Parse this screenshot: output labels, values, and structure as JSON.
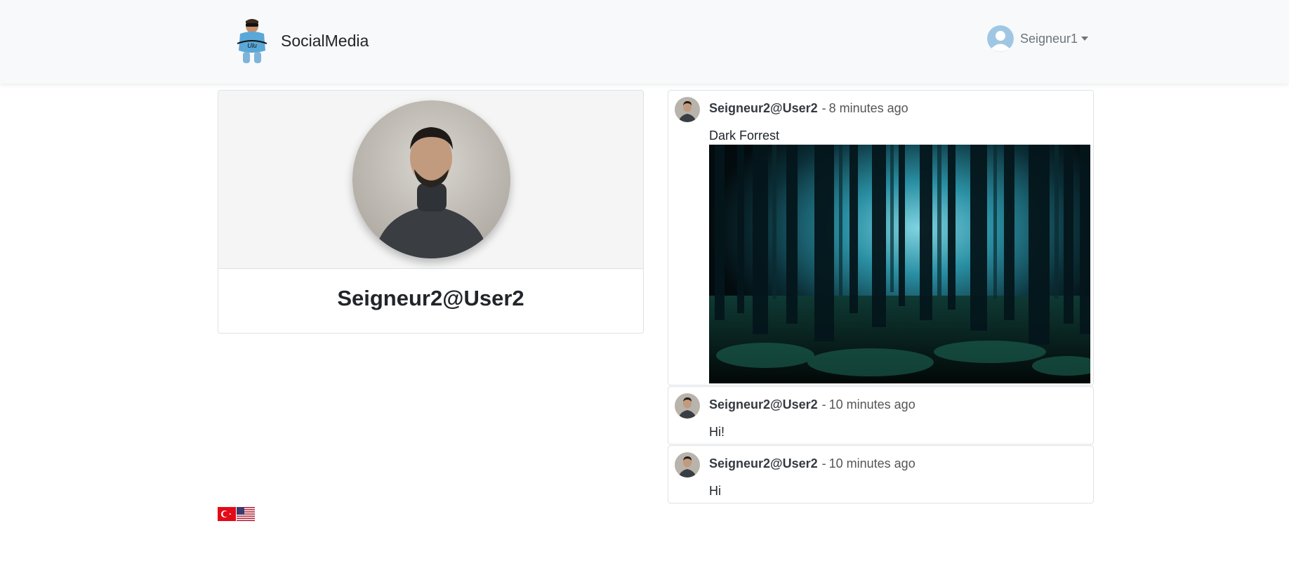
{
  "navbar": {
    "brand_name": "SocialMedia",
    "user_name": "Seigneur1"
  },
  "profile": {
    "username": "Seigneur2@User2"
  },
  "posts": [
    {
      "author": "Seigneur2@User2",
      "separator": "-",
      "time": "8 minutes ago",
      "text": "Dark Forrest",
      "has_image": true
    },
    {
      "author": "Seigneur2@User2",
      "separator": "-",
      "time": "10 minutes ago",
      "text": "Hi!"
    },
    {
      "author": "Seigneur2@User2",
      "separator": "-",
      "time": "10 minutes ago",
      "text": "Hi"
    }
  ],
  "languages": [
    {
      "code": "tr",
      "icon": "turkey-flag-icon"
    },
    {
      "code": "en",
      "icon": "usa-flag-icon"
    }
  ],
  "colors": {
    "navbar_bg": "#f8f9fa",
    "border": "#dee2e6",
    "muted_text": "#6c757d",
    "forest_accent": "#3aa6b9"
  }
}
